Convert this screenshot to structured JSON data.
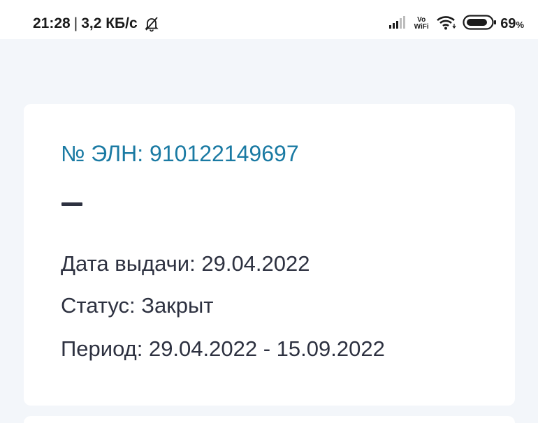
{
  "status_bar": {
    "time": "21:28",
    "separator": "|",
    "speed": "3,2 КБ/с",
    "vowifi_top": "Vo",
    "vowifi_bottom": "WiFi",
    "battery_value": "69",
    "battery_unit": "%"
  },
  "card": {
    "eln_label": "№ ЭЛН: 910122149697",
    "issue_date": "Дата выдачи: 29.04.2022",
    "status": "Статус: Закрыт",
    "period": "Период: 29.04.2022 - 15.09.2022"
  },
  "colors": {
    "accent": "#1a7aa3",
    "text": "#2d3140",
    "background": "#f3f6fa",
    "card": "#ffffff"
  }
}
